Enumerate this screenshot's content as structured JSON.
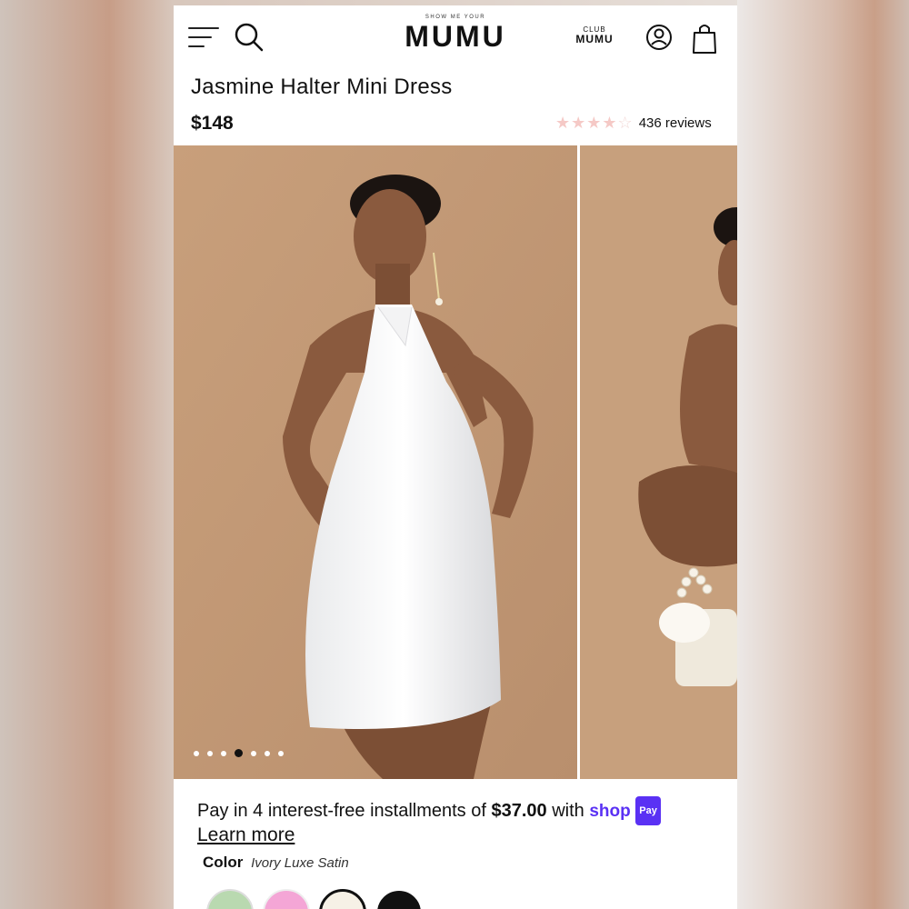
{
  "header": {
    "brand_tagline": "SHOW ME YOUR",
    "brand_name": "MUMU",
    "club_line1": "CLUB",
    "club_line2": "MUMU"
  },
  "product": {
    "title": "Jasmine Halter Mini Dress",
    "price": "$148",
    "rating": 4,
    "rating_max": 5,
    "reviews": "436 reviews"
  },
  "gallery": {
    "dot_count": 7,
    "active_dot": 4
  },
  "payment": {
    "prefix": "Pay in 4 interest-free installments of ",
    "amount": "$37.00",
    "suffix": " with ",
    "provider": "shop",
    "provider_badge": "Pay",
    "learn_more": "Learn more"
  },
  "color": {
    "label": "Color",
    "selected": "Ivory Luxe Satin",
    "swatches": [
      "#b9d9b0",
      "#f4a6d6",
      "#f6f1e6",
      "#111111"
    ]
  }
}
